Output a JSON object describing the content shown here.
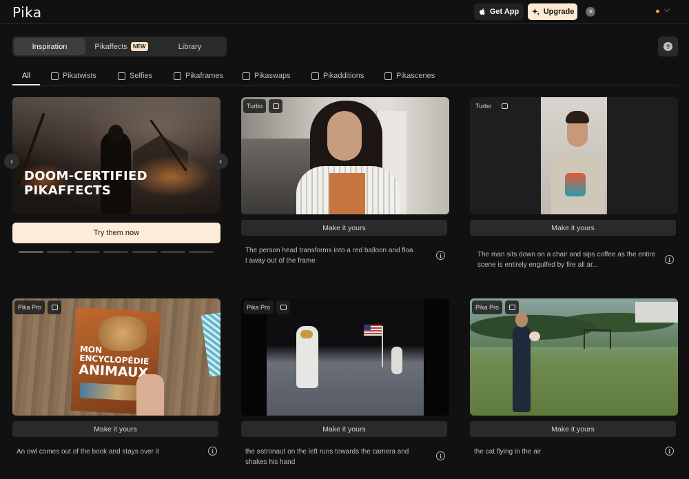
{
  "app": {
    "logo": "Pika",
    "get_app_label": "Get App",
    "upgrade_label": "Upgrade"
  },
  "main_tabs": [
    {
      "label": "Inspiration",
      "active": true
    },
    {
      "label": "Pikaffects",
      "badge": "NEW",
      "active": false
    },
    {
      "label": "Library",
      "active": false
    }
  ],
  "help_label": "?",
  "categories": [
    {
      "label": "All",
      "icon": "none",
      "active": true
    },
    {
      "label": "Pikatwists",
      "icon": "twist-icon"
    },
    {
      "label": "Selfies",
      "icon": "selfie-icon"
    },
    {
      "label": "Pikaframes",
      "icon": "frames-icon"
    },
    {
      "label": "Pikaswaps",
      "icon": "swap-icon"
    },
    {
      "label": "Pikadditions",
      "icon": "additions-icon"
    },
    {
      "label": "Pikascenes",
      "icon": "scenes-icon"
    }
  ],
  "hero": {
    "title_line1": "DOOM-CERTIFIED",
    "title_line2": "PIKAFFECTS",
    "cta_label": "Try them now",
    "prev_arrow": "‹",
    "next_arrow": "›",
    "slide_count": 7,
    "active_slide": 0
  },
  "cards": [
    {
      "model": "Turbo",
      "make_label": "Make it yours",
      "description": "The person head transforms into a red balloon and floa\nt away out of the frame",
      "info": "i"
    },
    {
      "model": "Turbo",
      "make_label": "Make it yours",
      "description": "The man sits down on a chair and sips coffee as the entire scene is entirely engulfed by fire all ar...",
      "info": "i"
    },
    {
      "model": "Pika Pro",
      "make_label": "Make it yours",
      "description": "An owl comes out of the book and stays over it",
      "info": "i",
      "book_title_line1": "MON",
      "book_title_line2": "ENCYCLOPÉDIE",
      "book_title_line3": "ANIMAUX"
    },
    {
      "model": "Pika Pro",
      "make_label": "Make it yours",
      "description": "the astronaut on the left runs towards the camera and shakes his hand",
      "info": "i"
    },
    {
      "model": "Pika Pro",
      "make_label": "Make it yours",
      "description": "the cat flying in the air",
      "info": "i"
    }
  ],
  "colors": {
    "background": "#111111",
    "upgrade_bg": "#fde9d4",
    "cta_bg": "#fcecd8",
    "badge_bg": "#fde2c2",
    "credits_dot": "#f5a623"
  }
}
